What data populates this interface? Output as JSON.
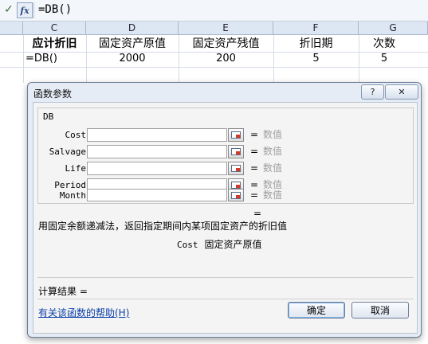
{
  "formula_bar": {
    "enter_icon": "checkmark-icon",
    "fx_label": "fx",
    "formula": "=DB()"
  },
  "sheet": {
    "columns": [
      "C",
      "D",
      "E",
      "F",
      "G"
    ],
    "row1": [
      "应计折旧",
      "固定资产原值",
      "固定资产残值",
      "折旧期",
      "次数"
    ],
    "row2": [
      "=DB()",
      "2000",
      "200",
      "5",
      "5"
    ]
  },
  "dialog": {
    "title": "函数参数",
    "help_icon": "question-icon",
    "close_icon": "close-icon",
    "function_name": "DB",
    "args": [
      {
        "name": "Cost",
        "eq": "=",
        "value": "数值"
      },
      {
        "name": "Salvage",
        "eq": "=",
        "value": "数值"
      },
      {
        "name": "Life",
        "eq": "=",
        "value": "数值"
      },
      {
        "name": "Period",
        "eq": "=",
        "value": "数值"
      },
      {
        "name": "Month",
        "eq": "=",
        "value": "数值"
      }
    ],
    "result_eq": "=",
    "description": "用固定余额递减法，返回指定期间内某项固定资产的折旧值",
    "arg_help": {
      "name": "Cost",
      "text": "固定资产原值"
    },
    "result_label": "计算结果 =",
    "help_link": "有关该函数的帮助(H)",
    "ok_label": "确定",
    "cancel_label": "取消"
  }
}
